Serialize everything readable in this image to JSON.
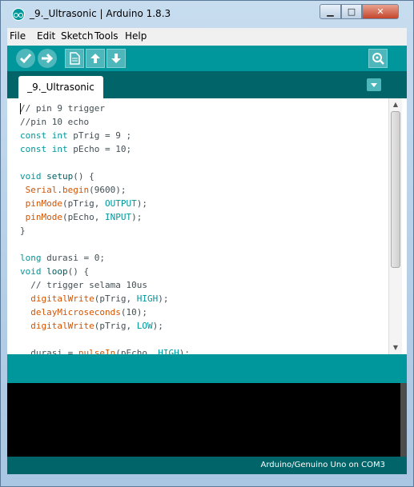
{
  "window": {
    "title": "_9._Ultrasonic | Arduino 1.8.3",
    "minimize": "▁",
    "maximize": "□",
    "close": "✕"
  },
  "menu": [
    "File",
    "Edit",
    "Sketch",
    "Tools",
    "Help"
  ],
  "toolbar": {
    "verify": "✓",
    "upload": "→",
    "new": "▤",
    "open": "↑",
    "save": "↓",
    "serial_monitor": "⌕"
  },
  "tab": {
    "label": "_9._Ultrasonic",
    "menu_arrow": "▼"
  },
  "code_lines": [
    [
      {
        "t": "// pin 9 trigger",
        "c": "cm"
      }
    ],
    [
      {
        "t": "//pin 10 echo",
        "c": "cm"
      }
    ],
    [
      {
        "t": "const",
        "c": "kw"
      },
      {
        "t": " "
      },
      {
        "t": "int",
        "c": "kw"
      },
      {
        "t": " pTrig = 9 ;"
      }
    ],
    [
      {
        "t": "const",
        "c": "kw"
      },
      {
        "t": " "
      },
      {
        "t": "int",
        "c": "kw"
      },
      {
        "t": " pEcho = 10;"
      }
    ],
    [],
    [
      {
        "t": "void",
        "c": "kw"
      },
      {
        "t": " "
      },
      {
        "t": "setup",
        "c": "dq"
      },
      {
        "t": "() {"
      }
    ],
    [
      {
        "t": " "
      },
      {
        "t": "Serial",
        "c": "fn"
      },
      {
        "t": "."
      },
      {
        "t": "begin",
        "c": "fn"
      },
      {
        "t": "(9600);"
      }
    ],
    [
      {
        "t": " "
      },
      {
        "t": "pinMode",
        "c": "fn"
      },
      {
        "t": "(pTrig, "
      },
      {
        "t": "OUTPUT",
        "c": "kw"
      },
      {
        "t": ");"
      }
    ],
    [
      {
        "t": " "
      },
      {
        "t": "pinMode",
        "c": "fn"
      },
      {
        "t": "(pEcho, "
      },
      {
        "t": "INPUT",
        "c": "kw"
      },
      {
        "t": ");"
      }
    ],
    [
      {
        "t": "}"
      }
    ],
    [],
    [
      {
        "t": "long",
        "c": "kw"
      },
      {
        "t": " durasi = 0;"
      }
    ],
    [
      {
        "t": "void",
        "c": "kw"
      },
      {
        "t": " "
      },
      {
        "t": "loop",
        "c": "dq"
      },
      {
        "t": "() {"
      }
    ],
    [
      {
        "t": "  // trigger selama 10us",
        "c": "cm"
      }
    ],
    [
      {
        "t": "  "
      },
      {
        "t": "digitalWrite",
        "c": "fn"
      },
      {
        "t": "(pTrig, "
      },
      {
        "t": "HIGH",
        "c": "kw"
      },
      {
        "t": ");"
      }
    ],
    [
      {
        "t": "  "
      },
      {
        "t": "delayMicroseconds",
        "c": "fn"
      },
      {
        "t": "(10);"
      }
    ],
    [
      {
        "t": "  "
      },
      {
        "t": "digitalWrite",
        "c": "fn"
      },
      {
        "t": "(pTrig, "
      },
      {
        "t": "LOW",
        "c": "kw"
      },
      {
        "t": ");"
      }
    ],
    [],
    [
      {
        "t": "  durasi = "
      },
      {
        "t": "pulseIn",
        "c": "fn"
      },
      {
        "t": "(pEcho, "
      },
      {
        "t": "HIGH",
        "c": "kw"
      },
      {
        "t": ");"
      }
    ]
  ],
  "scrollbar": {
    "up": "▲",
    "down": "▼"
  },
  "footer": {
    "board_port": "Arduino/Genuino Uno on COM3"
  }
}
